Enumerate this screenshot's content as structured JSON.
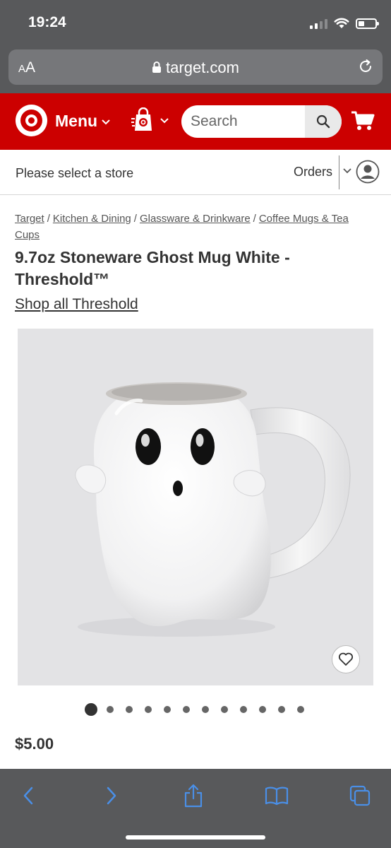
{
  "status_bar": {
    "time": "19:24",
    "cell_signal_bars": 2,
    "battery_level_percent": 35
  },
  "browser": {
    "aa_label_small": "A",
    "aa_label_large": "A",
    "url": "target.com"
  },
  "header": {
    "menu_label": "Menu",
    "search_placeholder": "Search",
    "brand_color": "#cc0000"
  },
  "store_bar": {
    "store_text": "Please select a store",
    "orders_label": "Orders"
  },
  "breadcrumb": {
    "items": [
      "Target",
      "Kitchen & Dining",
      "Glassware & Drinkware",
      "Coffee Mugs & Tea Cups"
    ],
    "separator": "/"
  },
  "product": {
    "title": "9.7oz Stoneware Ghost Mug White - Threshold™",
    "shop_all_label": "Shop all Threshold",
    "price": "$5.00",
    "image_count": 12,
    "active_image_index": 0
  },
  "icons": [
    "lock-icon",
    "reload-icon",
    "target-logo",
    "chevron-down-icon",
    "shopping-bag-icon",
    "search-icon",
    "cart-icon",
    "account-icon",
    "heart-icon",
    "back-icon",
    "forward-icon",
    "share-icon",
    "bookmarks-icon",
    "tabs-icon"
  ],
  "colors": {
    "browser_chrome": "#58595b",
    "toolbar_icon": "#4a8fe7",
    "image_background": "#e3e3e5"
  }
}
